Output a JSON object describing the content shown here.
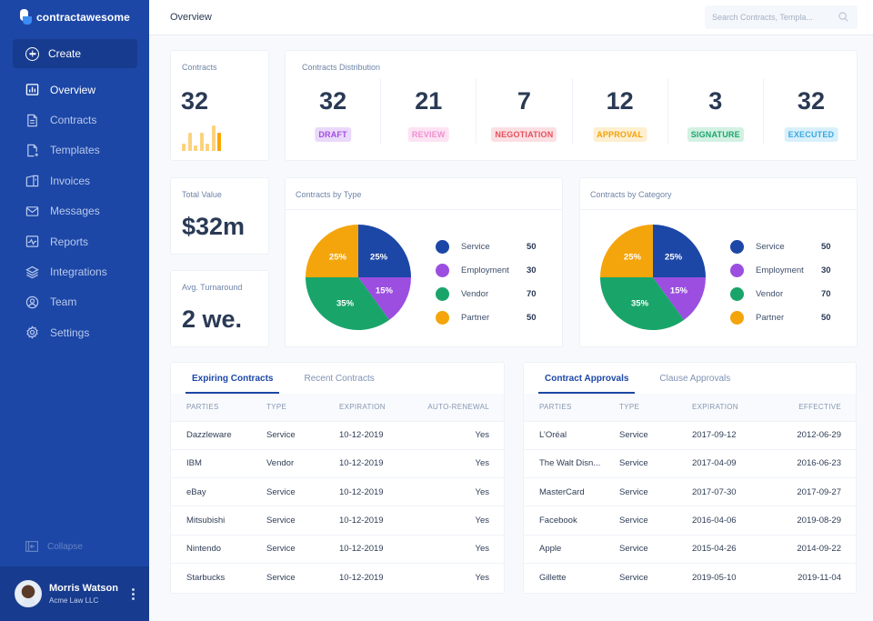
{
  "app": {
    "name": "contractawesome"
  },
  "sidebar": {
    "create_label": "Create",
    "items": [
      {
        "label": "Overview",
        "icon": "chart-icon",
        "active": true
      },
      {
        "label": "Contracts",
        "icon": "document-icon"
      },
      {
        "label": "Templates",
        "icon": "template-icon"
      },
      {
        "label": "Invoices",
        "icon": "invoice-icon"
      },
      {
        "label": "Messages",
        "icon": "mail-icon"
      },
      {
        "label": "Reports",
        "icon": "report-icon"
      },
      {
        "label": "Integrations",
        "icon": "layers-icon"
      },
      {
        "label": "Team",
        "icon": "user-circle-icon"
      },
      {
        "label": "Settings",
        "icon": "gear-icon"
      }
    ],
    "collapse_label": "Collapse",
    "user": {
      "name": "Morris Watson",
      "org": "Acme Law LLC"
    }
  },
  "header": {
    "title": "Overview",
    "search_placeholder": "Search Contracts, Templa..."
  },
  "stats": {
    "contracts": {
      "label": "Contracts",
      "value": "32",
      "sparkline": [
        30,
        70,
        20,
        70,
        30,
        100,
        70
      ]
    },
    "total_value": {
      "label": "Total Value",
      "value": "$32m"
    },
    "turnaround": {
      "label": "Avg. Turnaround",
      "value": "2 we."
    }
  },
  "distribution": {
    "label": "Contracts Distribution",
    "items": [
      {
        "value": "32",
        "status": "DRAFT",
        "fg": "#a24fe0",
        "bg": "#ead9fb"
      },
      {
        "value": "21",
        "status": "REVIEW",
        "fg": "#ee8fcf",
        "bg": "#fce3f3"
      },
      {
        "value": "7",
        "status": "NEGOTIATION",
        "fg": "#e5505e",
        "bg": "#fbdfe2"
      },
      {
        "value": "12",
        "status": "APPROVAL",
        "fg": "#f2a20c",
        "bg": "#fdefcf"
      },
      {
        "value": "3",
        "status": "SIGNATURE",
        "fg": "#1ba56b",
        "bg": "#d3f1e3"
      },
      {
        "value": "32",
        "status": "EXECUTED",
        "fg": "#3aa9e0",
        "bg": "#d8f0fb"
      }
    ]
  },
  "chart_data": [
    {
      "type": "pie",
      "title": "Contracts by Type",
      "categories": [
        "Service",
        "Employment",
        "Vendor",
        "Partner"
      ],
      "values": [
        50,
        30,
        70,
        50
      ],
      "percent_labels": [
        "25%",
        "15%",
        "35%",
        "25%"
      ],
      "colors": [
        "#1c47a6",
        "#9b4ee0",
        "#19a56a",
        "#f4a50c"
      ],
      "legend": "right"
    },
    {
      "type": "pie",
      "title": "Contracts by Category",
      "categories": [
        "Service",
        "Employment",
        "Vendor",
        "Partner"
      ],
      "values": [
        50,
        30,
        70,
        50
      ],
      "percent_labels": [
        "25%",
        "15%",
        "35%",
        "25%"
      ],
      "colors": [
        "#1c47a6",
        "#9b4ee0",
        "#19a56a",
        "#f4a50c"
      ],
      "legend": "right"
    }
  ],
  "expiring": {
    "tabs": [
      "Expiring Contracts",
      "Recent Contracts"
    ],
    "columns": [
      "PARTIES",
      "TYPE",
      "EXPIRATION",
      "AUTO-RENEWAL"
    ],
    "rows": [
      [
        "Dazzleware",
        "Service",
        "10-12-2019",
        "Yes"
      ],
      [
        "IBM",
        "Vendor",
        "10-12-2019",
        "Yes"
      ],
      [
        "eBay",
        "Service",
        "10-12-2019",
        "Yes"
      ],
      [
        "Mitsubishi",
        "Service",
        "10-12-2019",
        "Yes"
      ],
      [
        "Nintendo",
        "Service",
        "10-12-2019",
        "Yes"
      ],
      [
        "Starbucks",
        "Service",
        "10-12-2019",
        "Yes"
      ]
    ]
  },
  "approvals": {
    "tabs": [
      "Contract Approvals",
      "Clause Approvals"
    ],
    "columns": [
      "PARTIES",
      "TYPE",
      "EXPIRATION",
      "EFFECTIVE"
    ],
    "rows": [
      [
        "L’Oréal",
        "Service",
        "2017-09-12",
        "2012-06-29"
      ],
      [
        "The Walt Disn...",
        "Service",
        "2017-04-09",
        "2016-06-23"
      ],
      [
        "MasterCard",
        "Service",
        "2017-07-30",
        "2017-09-27"
      ],
      [
        "Facebook",
        "Service",
        "2016-04-06",
        "2019-08-29"
      ],
      [
        "Apple",
        "Service",
        "2015-04-26",
        "2014-09-22"
      ],
      [
        "Gillette",
        "Service",
        "2019-05-10",
        "2019-11-04"
      ]
    ]
  }
}
